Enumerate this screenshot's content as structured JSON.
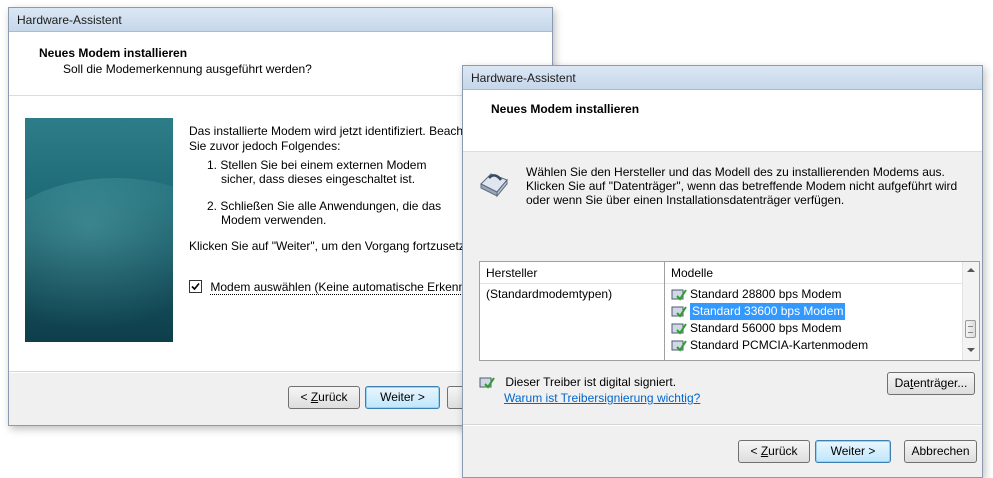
{
  "left_window": {
    "title": "Hardware-Assistent",
    "header_title": "Neues Modem installieren",
    "header_subtitle": "Soll die Modemerkennung ausgeführt werden?",
    "intro": "Das installierte Modem wird jetzt identifiziert. Beachten Sie zuvor jedoch Folgendes:",
    "step1": "1.  Stellen Sie bei einem externen Modem sicher, dass dieses eingeschaltet ist.",
    "step2": "2.  Schließen Sie alle Anwendungen, die das Modem verwenden.",
    "continue_text": "Klicken Sie auf \"Weiter\", um den Vorgang fortzusetzen.",
    "checkbox_label": "Modem auswählen (Keine automatische Erkennung)",
    "checkbox_checked": true,
    "back_label_prefix": "< ",
    "back_label_accel": "Z",
    "back_label_rest": "urück",
    "next_label": "Weiter >"
  },
  "right_window": {
    "title": "Hardware-Assistent",
    "header_title": "Neues Modem installieren",
    "description": "Wählen Sie den Hersteller und das Modell des zu installierenden Modems aus. Klicken Sie auf \"Datenträger\", wenn das betreffende Modem nicht aufgeführt wird oder wenn Sie über einen Installationsdatenträger verfügen.",
    "manufacturer_header": "Hersteller",
    "manufacturers": [
      "(Standardmodemtypen)"
    ],
    "models_header": "Modelle",
    "models": [
      "Standard 28800 bps Modem",
      "Standard 33600 bps Modem",
      "Standard 56000 bps Modem",
      "Standard PCMCIA-Kartenmodem"
    ],
    "selected_model": "Standard 33600 bps Modem",
    "signed_text": "Dieser Treiber ist digital signiert.",
    "signing_link": "Warum ist Treibersignierung wichtig?",
    "disk_label_prefix": "Da",
    "disk_label_accel": "t",
    "disk_label_rest": "enträger...",
    "back_label_prefix": "< ",
    "back_label_accel": "Z",
    "back_label_rest": "urück",
    "next_label": "Weiter >",
    "cancel_label": "Abbrechen"
  },
  "colors": {
    "selection": "#3399ff",
    "link": "#0066cc",
    "panel_teal": "#1f6b78"
  }
}
